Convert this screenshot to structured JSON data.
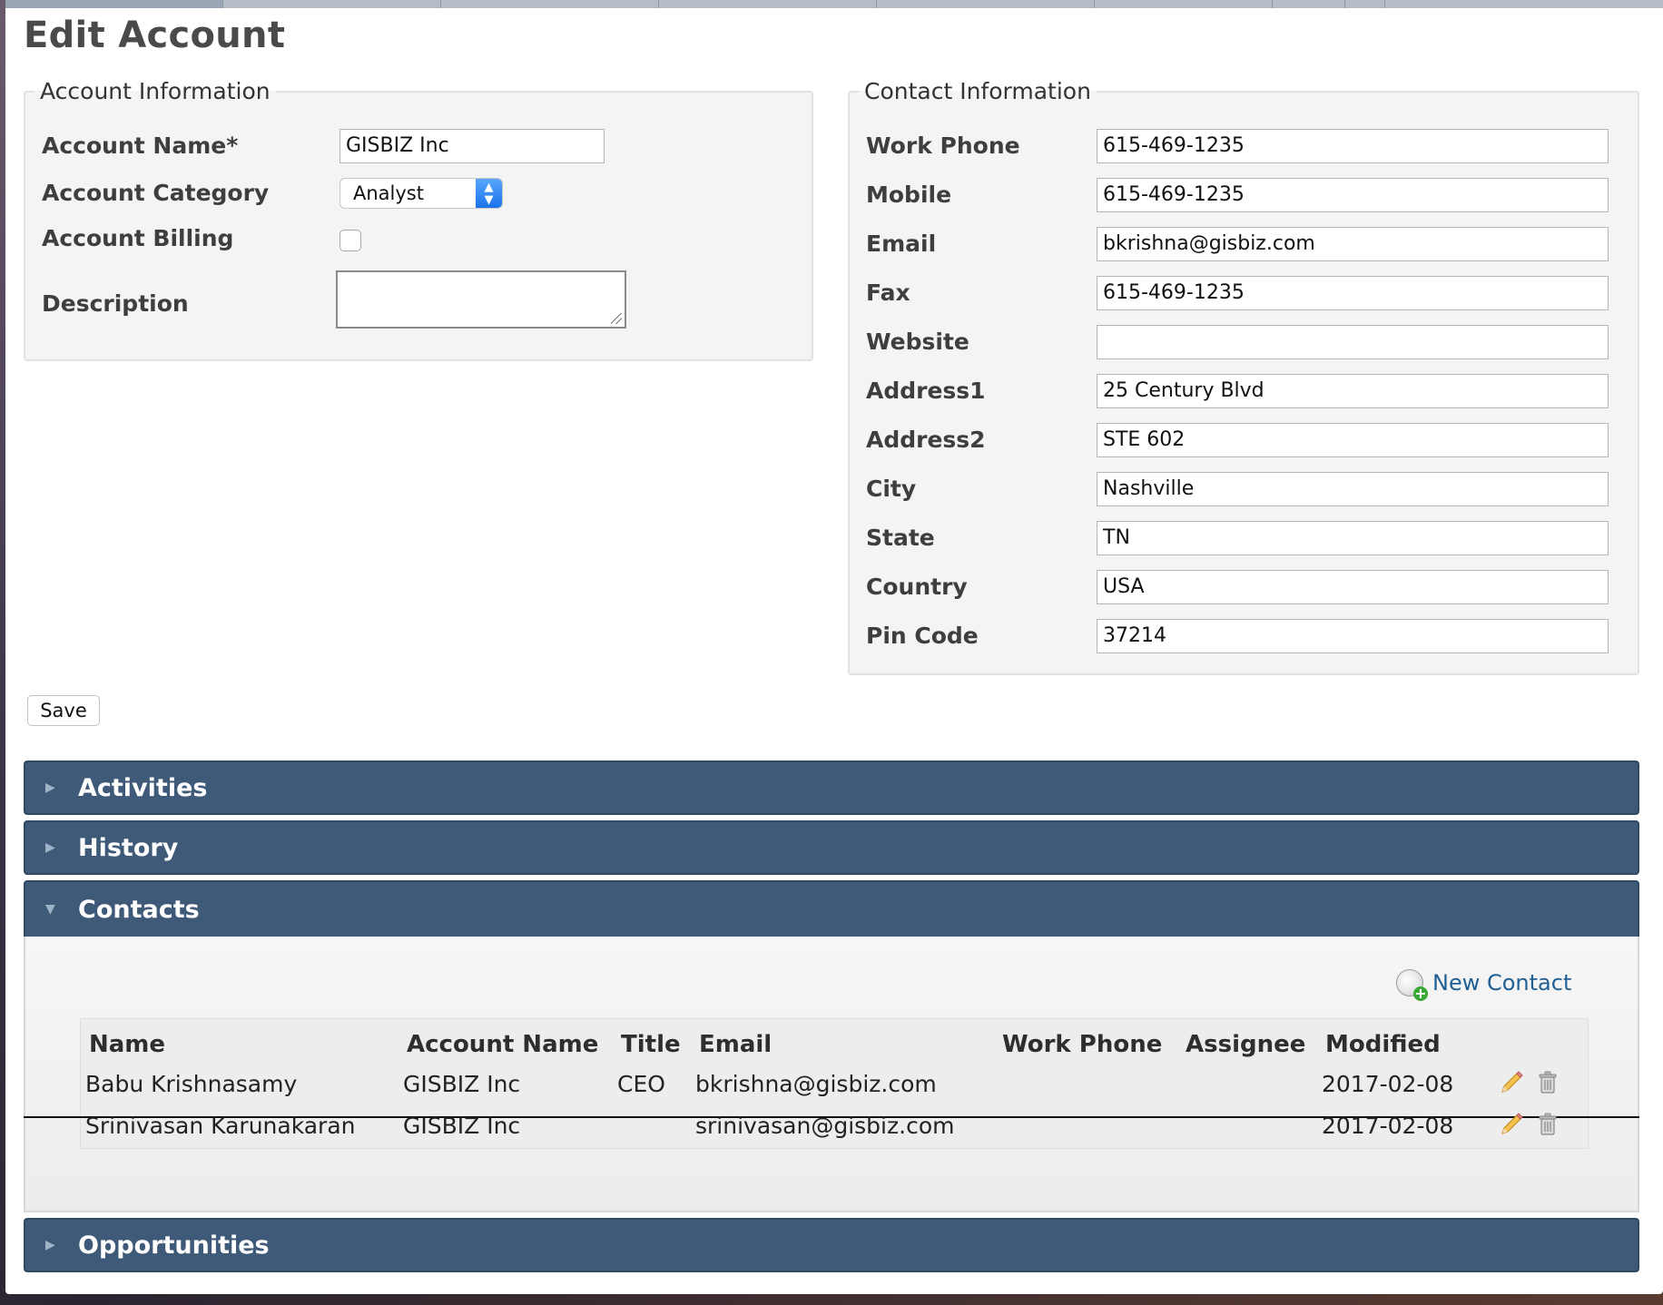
{
  "page": {
    "title": "Edit Account"
  },
  "account_info": {
    "legend": "Account Information",
    "fields": {
      "account_name": {
        "label": "Account Name*",
        "value": "GISBIZ Inc"
      },
      "account_category": {
        "label": "Account Category",
        "value": "Analyst"
      },
      "account_billing": {
        "label": "Account Billing",
        "checked": false
      },
      "description": {
        "label": "Description",
        "value": ""
      }
    }
  },
  "contact_info": {
    "legend": "Contact Information",
    "fields": [
      {
        "label": "Work Phone",
        "value": "615-469-1235"
      },
      {
        "label": "Mobile",
        "value": "615-469-1235"
      },
      {
        "label": "Email",
        "value": "bkrishna@gisbiz.com"
      },
      {
        "label": "Fax",
        "value": "615-469-1235"
      },
      {
        "label": "Website",
        "value": ""
      },
      {
        "label": "Address1",
        "value": "25 Century Blvd"
      },
      {
        "label": "Address2",
        "value": "STE 602"
      },
      {
        "label": "City",
        "value": "Nashville"
      },
      {
        "label": "State",
        "value": "TN"
      },
      {
        "label": "Country",
        "value": "USA"
      },
      {
        "label": "Pin Code",
        "value": "37214"
      }
    ]
  },
  "actions": {
    "save_label": "Save"
  },
  "panels": {
    "activities": {
      "title": "Activities",
      "expanded": false
    },
    "history": {
      "title": "History",
      "expanded": false
    },
    "contacts": {
      "title": "Contacts",
      "expanded": true
    },
    "opportunities": {
      "title": "Opportunities",
      "expanded": false
    }
  },
  "contacts": {
    "new_contact_label": "New Contact",
    "columns": [
      "Name",
      "Account Name",
      "Title",
      "Email",
      "Work Phone",
      "Assignee",
      "Modified"
    ],
    "rows": [
      {
        "name": "Babu Krishnasamy",
        "account_name": "GISBIZ Inc",
        "title": "CEO",
        "email": "bkrishna@gisbiz.com",
        "work_phone": "",
        "assignee": "",
        "modified": "2017-02-08"
      },
      {
        "name": "Srinivasan Karunakaran",
        "account_name": "GISBIZ Inc",
        "title": "",
        "email": "srinivasan@gisbiz.com",
        "work_phone": "",
        "assignee": "",
        "modified": "2017-02-08"
      }
    ]
  },
  "colors": {
    "panel_header": "#3e5a78",
    "link": "#1f5f93",
    "select_accent": "#1a73ea"
  },
  "icons": {
    "panel_collapsed": "caret-right-icon",
    "panel_expanded": "caret-down-icon",
    "new_contact": "add-contact-icon",
    "edit": "pencil-icon",
    "delete": "trash-icon"
  }
}
